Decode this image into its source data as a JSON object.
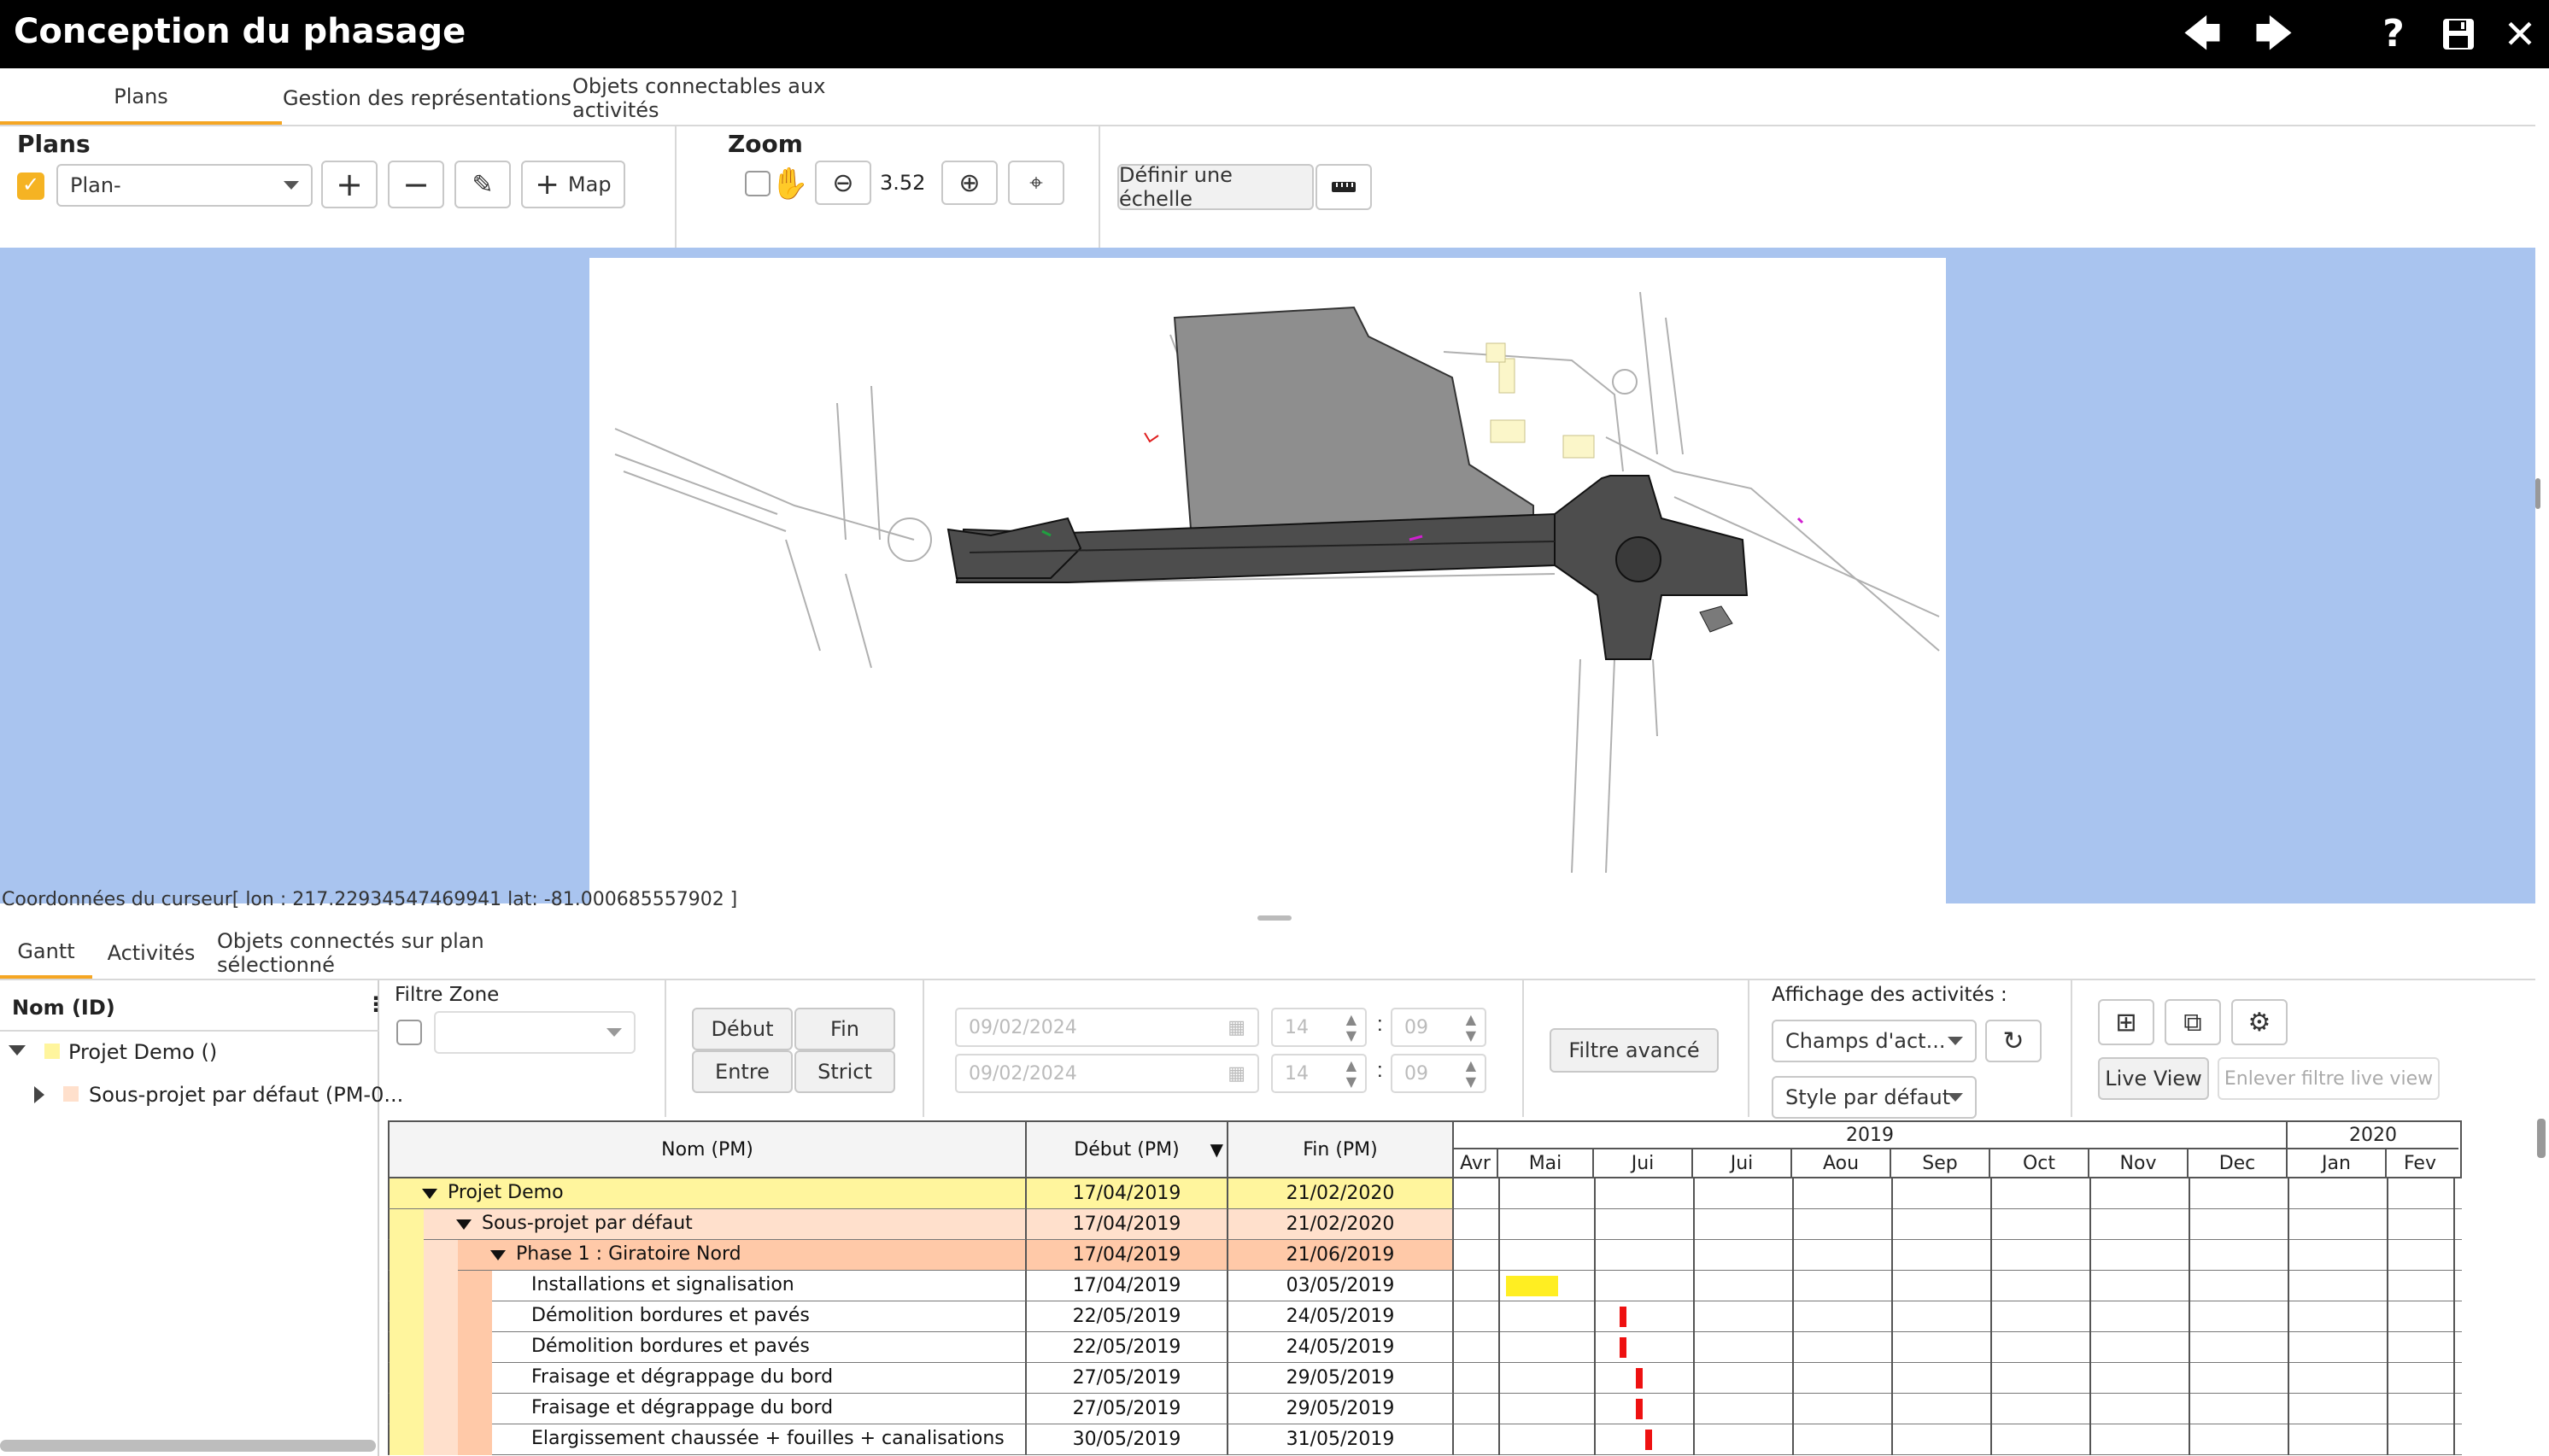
{
  "app": {
    "title": "Conception du phasage"
  },
  "top_tabs": [
    "Plans",
    "Gestion des représentations",
    "Objets connectables aux activités"
  ],
  "plans": {
    "label": "Plans",
    "plan_select": "Plan-",
    "map_button": "Map"
  },
  "zoom": {
    "label": "Zoom",
    "value": "3.52"
  },
  "scale": {
    "button": "Définir une échelle"
  },
  "cursor_coords": "Coordonnées du curseur[ lon : 217.22934547469941 lat: -81.000685557902 ]",
  "bottom_tabs": [
    "Gantt",
    "Activités",
    "Objets connectés sur plan sélectionné"
  ],
  "tree": {
    "header": "Nom (ID)",
    "items": [
      {
        "label": "Projet Demo ()",
        "color": "#fff59d"
      },
      {
        "label": "Sous-projet par défaut (PM-0...",
        "color": "#ffe0cc"
      }
    ]
  },
  "filters": {
    "zone_label": "Filtre Zone",
    "buttons": [
      "Début",
      "Fin",
      "Entre",
      "Strict"
    ],
    "date1": "09/02/2024",
    "date2": "09/02/2024",
    "hour": "14",
    "minute": "09",
    "advanced": "Filtre avancé",
    "display_label": "Affichage des activités :",
    "fields_select": "Champs d'act...",
    "style_select": "Style par défaut",
    "live_view": "Live View",
    "remove_live": "Enlever filtre live view"
  },
  "gantt": {
    "col_name": "Nom (PM)",
    "col_start": "Début (PM)",
    "col_end": "Fin (PM)",
    "years": [
      "2019",
      "2020"
    ],
    "months": [
      "Avr",
      "Mai",
      "Jui",
      "Jui",
      "Aou",
      "Sep",
      "Oct",
      "Nov",
      "Dec",
      "Jan",
      "Fev"
    ],
    "rows": [
      {
        "name": "Projet Demo",
        "start": "17/04/2019",
        "end": "21/02/2020",
        "level": 0,
        "kind": "project",
        "expand": true
      },
      {
        "name": "Sous-projet par défaut",
        "start": "17/04/2019",
        "end": "21/02/2020",
        "level": 1,
        "kind": "subproject",
        "expand": true
      },
      {
        "name": "Phase 1 : Giratoire Nord",
        "start": "17/04/2019",
        "end": "21/06/2019",
        "level": 2,
        "kind": "phase",
        "expand": true
      },
      {
        "name": "Installations et signalisation",
        "start": "17/04/2019",
        "end": "03/05/2019",
        "level": 3,
        "kind": "task",
        "bar_color": "#ffee22"
      },
      {
        "name": "Démolition bordures et pavés",
        "start": "22/05/2019",
        "end": "24/05/2019",
        "level": 3,
        "kind": "task",
        "bar_color": "#ee1111"
      },
      {
        "name": "Démolition bordures et pavés",
        "start": "22/05/2019",
        "end": "24/05/2019",
        "level": 3,
        "kind": "task",
        "bar_color": "#ee1111"
      },
      {
        "name": "Fraisage et dégrappage du bord",
        "start": "27/05/2019",
        "end": "29/05/2019",
        "level": 3,
        "kind": "task",
        "bar_color": "#ee1111"
      },
      {
        "name": "Fraisage et dégrappage du bord",
        "start": "27/05/2019",
        "end": "29/05/2019",
        "level": 3,
        "kind": "task",
        "bar_color": "#ee1111"
      },
      {
        "name": "Elargissement chaussée + fouilles + canalisations",
        "start": "30/05/2019",
        "end": "31/05/2019",
        "level": 3,
        "kind": "task",
        "bar_color": "#ee1111"
      }
    ]
  },
  "colors": {
    "accent": "#f5a623",
    "map_background": "#a9c4ef",
    "project_row": "#fff59d",
    "subproject_row": "#ffe0cc",
    "phase_row": "#ffc9a8"
  }
}
